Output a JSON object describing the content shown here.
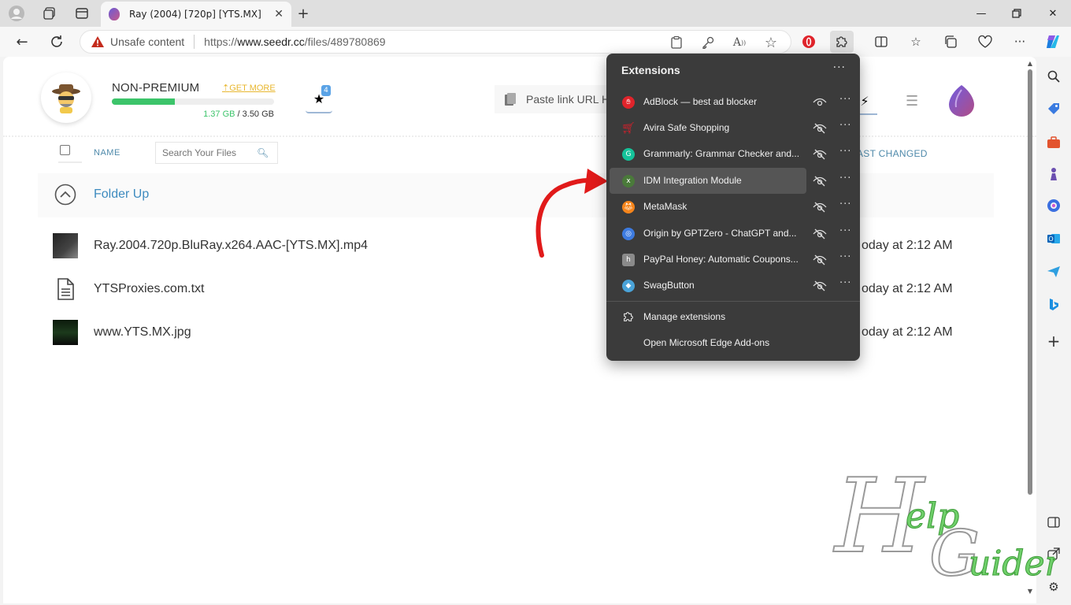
{
  "browser": {
    "tab_title": "Ray (2004) [720p] [YTS.MX]",
    "security_label": "Unsafe content",
    "url_prefix": "https://",
    "url_host": "www.seedr.cc",
    "url_path": "/files/489780869"
  },
  "account": {
    "plan": "NON-PREMIUM",
    "get_more": "GET MORE",
    "used": "1.37 GB",
    "separator": " / ",
    "total": "3.50 GB",
    "usage_fraction": 0.39,
    "star_badge_count": "4"
  },
  "toolbar": {
    "paste_placeholder": "Paste link URL H"
  },
  "file_table": {
    "name_header": "NAME",
    "search_placeholder": "Search Your Files",
    "changed_header": "AST CHANGED",
    "folder_up": "Folder Up",
    "rows": [
      {
        "name": "Ray.2004.720p.BluRay.x264.AAC-[YTS.MX].mp4",
        "date": "oday at 2:12 AM",
        "type": "video"
      },
      {
        "name": "YTSProxies.com.txt",
        "date": "oday at 2:12 AM",
        "type": "text"
      },
      {
        "name": "www.YTS.MX.jpg",
        "date": "oday at 2:12 AM",
        "type": "image"
      }
    ]
  },
  "extensions_popup": {
    "title": "Extensions",
    "items": [
      {
        "name": "AdBlock — best ad blocker",
        "icon": "adblock-icon",
        "color": "#e0242b",
        "visible": true
      },
      {
        "name": "Avira Safe Shopping",
        "icon": "avira-icon",
        "color": "#d5202b",
        "visible": false
      },
      {
        "name": "Grammarly: Grammar Checker and...",
        "icon": "grammarly-icon",
        "color": "#15c39a",
        "visible": false
      },
      {
        "name": "IDM Integration Module",
        "icon": "idm-icon",
        "color": "#4a7a3a",
        "visible": false
      },
      {
        "name": "MetaMask",
        "icon": "metamask-icon",
        "color": "#f6851b",
        "visible": false
      },
      {
        "name": "Origin by GPTZero - ChatGPT and...",
        "icon": "gptzero-icon",
        "color": "#3d7be0",
        "visible": false
      },
      {
        "name": "PayPal Honey: Automatic Coupons...",
        "icon": "honey-icon",
        "color": "#8a8a8a",
        "visible": false
      },
      {
        "name": "SwagButton",
        "icon": "swagbutton-icon",
        "color": "#4aa3d8",
        "visible": false
      }
    ],
    "manage": "Manage extensions",
    "addons": "Open Microsoft Edge Add-ons"
  },
  "watermark": {
    "text": "Help Guider"
  }
}
